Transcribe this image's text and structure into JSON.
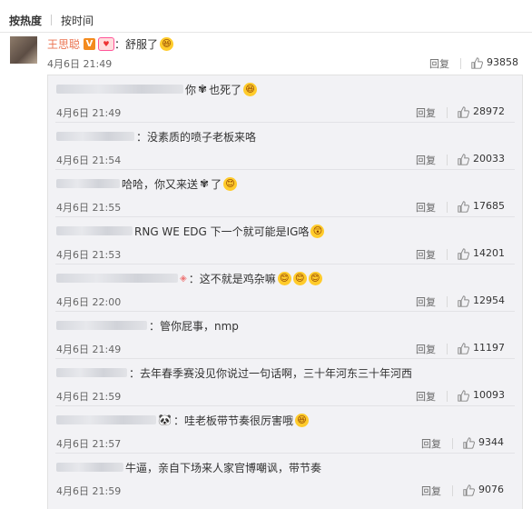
{
  "tabs": [
    {
      "label": "按热度",
      "active": true
    },
    {
      "label": "按时间",
      "active": false
    }
  ],
  "main": {
    "user": "王思聪",
    "badge": "V",
    "text": "：舒服了",
    "emoji": "laugh-emoji",
    "time": "4月6日 21:49",
    "reply": "回复",
    "likes": "93858"
  },
  "replies": [
    {
      "text": "你",
      "extra": "也死了",
      "emoji": "laugh-emoji",
      "time": "4月6日 21:49",
      "reply": "回复",
      "likes": "28972"
    },
    {
      "text": "：没素质的喷子老板来咯",
      "time": "4月6日 21:54",
      "reply": "回复",
      "likes": "20033"
    },
    {
      "text": "哈哈，你又来送",
      "extra": "了",
      "emoji": "smile-emoji",
      "time": "4月6日 21:55",
      "reply": "回复",
      "likes": "17685"
    },
    {
      "text": "RNG WE EDG 下一个就可能是IG咯",
      "emoji": "surprise-emoji",
      "time": "4月6日 21:53",
      "reply": "回复",
      "likes": "14201"
    },
    {
      "text": "：这不就是鸡杂嘛",
      "emoji": "smile-emoji",
      "time": "4月6日 22:00",
      "reply": "回复",
      "likes": "12954"
    },
    {
      "text": "：管你屁事，nmp",
      "time": "4月6日 21:49",
      "reply": "回复",
      "likes": "11197"
    },
    {
      "text": "：去年春季赛没见你说过一句话啊，三十年河东三十年河西",
      "time": "4月6日 21:59",
      "reply": "回复",
      "likes": "10093"
    },
    {
      "text": "：哇老板带节奏很厉害哦",
      "emoji": "laugh-emoji",
      "time": "4月6日 21:57",
      "reply": "回复",
      "likes": "9344"
    },
    {
      "text": "牛逼，亲自下场来人家官博嘲讽，带节奏",
      "time": "4月6日 21:59",
      "reply": "回复",
      "likes": "9076"
    }
  ],
  "colors": {
    "username": "#eb7350",
    "vbadge": "#f38b1f",
    "subbox": "#f2f2f5"
  }
}
